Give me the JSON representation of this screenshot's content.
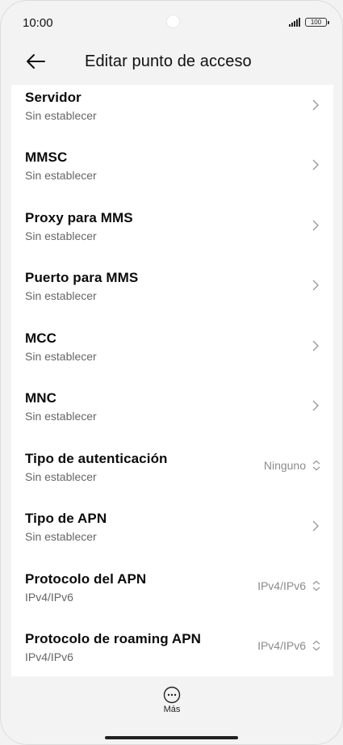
{
  "status": {
    "time": "10:00",
    "battery": "100"
  },
  "header": {
    "title": "Editar punto de acceso"
  },
  "items": [
    {
      "title": "Servidor",
      "subtitle": "Sin establecer"
    },
    {
      "title": "MMSC",
      "subtitle": "Sin establecer"
    },
    {
      "title": "Proxy para MMS",
      "subtitle": "Sin establecer"
    },
    {
      "title": "Puerto para MMS",
      "subtitle": "Sin establecer"
    },
    {
      "title": "MCC",
      "subtitle": "Sin establecer"
    },
    {
      "title": "MNC",
      "subtitle": "Sin establecer"
    },
    {
      "title": "Tipo de autenticación",
      "subtitle": "Sin establecer",
      "value": "Ninguno"
    },
    {
      "title": "Tipo de APN",
      "subtitle": "Sin establecer"
    },
    {
      "title": "Protocolo del APN",
      "subtitle": "IPv4/IPv6",
      "value": "IPv4/IPv6"
    },
    {
      "title": "Protocolo de roaming APN",
      "subtitle": "IPv4/IPv6",
      "value": "IPv4/IPv6"
    }
  ],
  "footer": {
    "more_label": "Más"
  }
}
